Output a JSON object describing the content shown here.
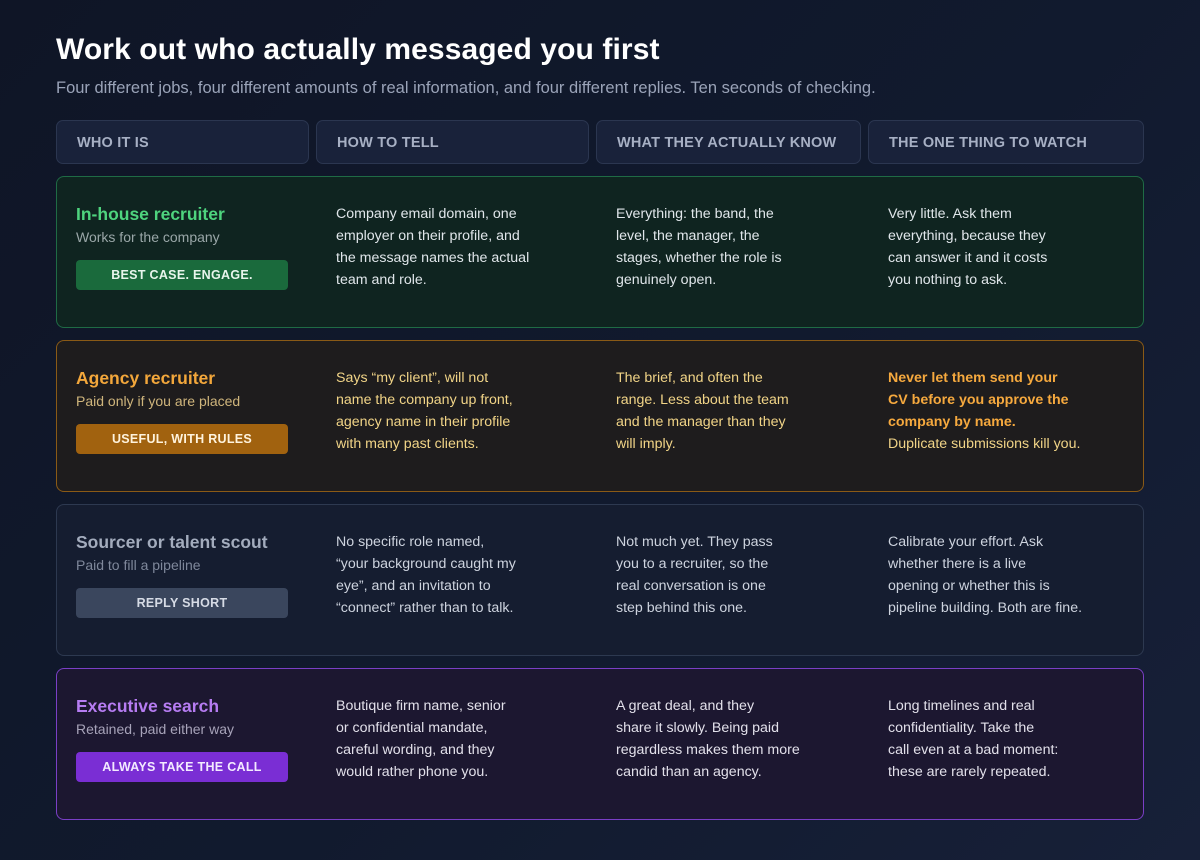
{
  "title": "Work out who actually messaged you first",
  "subtitle": "Four different jobs, four different amounts of real information, and four different replies. Ten seconds of checking.",
  "headers": [
    "WHO IT IS",
    "HOW TO TELL",
    "WHAT THEY ACTUALLY KNOW",
    "THE ONE THING TO WATCH"
  ],
  "rows": [
    {
      "role": "In-house recruiter",
      "sub": "Works for the company",
      "badge": "BEST CASE. ENGAGE.",
      "tell": [
        "Company email domain, one",
        "employer on their profile, and",
        "the message names the actual",
        "team and role."
      ],
      "know": [
        "Everything: the band, the",
        "level, the manager, the",
        "stages, whether the role is",
        "genuinely open."
      ],
      "watch": [
        "Very little. Ask them",
        "everything, because they",
        "can answer it and it costs",
        "you nothing to ask."
      ]
    },
    {
      "role": "Agency recruiter",
      "sub": "Paid only if you are placed",
      "badge": "USEFUL, WITH RULES",
      "tell": [
        "Says “my client”, will not",
        "name the company up front,",
        "agency name in their profile",
        "with many past clients."
      ],
      "know": [
        "The brief, and often the",
        "range. Less about the team",
        "and the manager than they",
        "will imply."
      ],
      "watch_strong": [
        "Never let them send your",
        "CV before you approve the",
        "company by name."
      ],
      "watch": [
        "Duplicate submissions kill you."
      ]
    },
    {
      "role": "Sourcer or talent scout",
      "sub": "Paid to fill a pipeline",
      "badge": "REPLY SHORT",
      "tell": [
        "No specific role named,",
        "“your background caught my",
        "eye”, and an invitation to",
        "“connect” rather than to talk."
      ],
      "know": [
        "Not much yet. They pass",
        "you to a recruiter, so the",
        "real conversation is one",
        "step behind this one."
      ],
      "watch": [
        "Calibrate your effort. Ask",
        "whether there is a live",
        "opening or whether this is",
        "pipeline building. Both are fine."
      ]
    },
    {
      "role": "Executive search",
      "sub": "Retained, paid either way",
      "badge": "ALWAYS TAKE THE CALL",
      "tell": [
        "Boutique firm name, senior",
        "or confidential mandate,",
        "careful wording, and they",
        "would rather phone you."
      ],
      "know": [
        "A great deal, and they",
        "share it slowly. Being paid",
        "regardless makes them more",
        "candid than an agency."
      ],
      "watch": [
        "Long timelines and real",
        "confidentiality. Take the",
        "call even at a bad moment:",
        "these are rarely repeated."
      ]
    }
  ]
}
